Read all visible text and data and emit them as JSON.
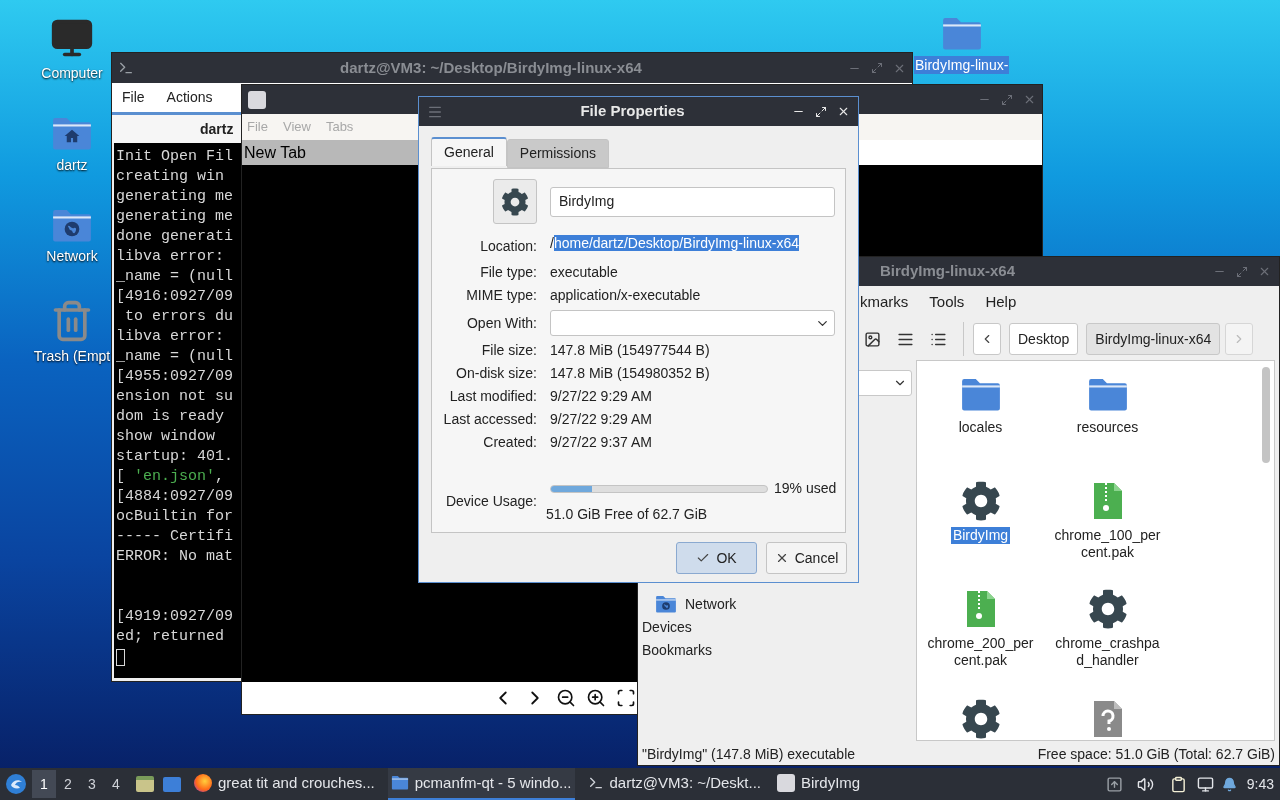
{
  "desktop": {
    "icons": [
      {
        "label": "Computer",
        "kind": "computer",
        "selected": false
      },
      {
        "label": "dartz",
        "kind": "home",
        "selected": false
      },
      {
        "label": "Network",
        "kind": "network",
        "selected": false
      },
      {
        "label": "Trash (Empt",
        "kind": "trash",
        "selected": false
      },
      {
        "label": "BirdyImg-linux-",
        "kind": "folder",
        "selected": true
      }
    ]
  },
  "terminal": {
    "title": "dartz@VM3: ~/Desktop/BirdyImg-linux-x64",
    "menu": [
      "File",
      "Actions"
    ],
    "tab": "dartz",
    "lines": [
      {
        "kind": "text",
        "segments": [
          {
            "text": "Init Open Fil",
            "kind": "plain"
          }
        ]
      },
      {
        "kind": "text",
        "segments": [
          {
            "text": "creating win",
            "kind": "plain"
          }
        ]
      },
      {
        "kind": "text",
        "segments": [
          {
            "text": "generating me",
            "kind": "plain"
          }
        ]
      },
      {
        "kind": "text",
        "segments": [
          {
            "text": "generating me",
            "kind": "plain"
          }
        ]
      },
      {
        "kind": "text",
        "segments": [
          {
            "text": "done generati",
            "kind": "plain"
          }
        ]
      },
      {
        "kind": "text",
        "segments": [
          {
            "text": "libva error:",
            "kind": "plain"
          }
        ]
      },
      {
        "kind": "text",
        "segments": [
          {
            "text": "_name = (null",
            "kind": "plain"
          }
        ]
      },
      {
        "kind": "text",
        "segments": [
          {
            "text": "[4916:0927/09",
            "kind": "plain"
          }
        ]
      },
      {
        "kind": "text",
        "segments": [
          {
            "text": " to errors du",
            "kind": "plain"
          }
        ]
      },
      {
        "kind": "text",
        "segments": [
          {
            "text": "libva error:",
            "kind": "plain"
          }
        ]
      },
      {
        "kind": "text",
        "segments": [
          {
            "text": "_name = (null",
            "kind": "plain"
          }
        ]
      },
      {
        "kind": "text",
        "segments": [
          {
            "text": "[4955:0927/09",
            "kind": "plain"
          }
        ]
      },
      {
        "kind": "text",
        "segments": [
          {
            "text": "ension not su",
            "kind": "plain"
          }
        ]
      },
      {
        "kind": "text",
        "segments": [
          {
            "text": "dom is ready",
            "kind": "plain"
          }
        ]
      },
      {
        "kind": "text",
        "segments": [
          {
            "text": "show window",
            "kind": "plain"
          }
        ]
      },
      {
        "kind": "text",
        "segments": [
          {
            "text": "startup: 401.",
            "kind": "plain"
          }
        ]
      },
      {
        "kind": "text",
        "segments": [
          {
            "text": "[ ",
            "kind": "plain"
          },
          {
            "text": "'en.json'",
            "kind": "string"
          },
          {
            "text": ",",
            "kind": "plain"
          }
        ]
      },
      {
        "kind": "text",
        "segments": [
          {
            "text": "[4884:0927/09",
            "kind": "plain"
          }
        ]
      },
      {
        "kind": "text",
        "segments": [
          {
            "text": "ocBuiltin for",
            "kind": "plain"
          }
        ]
      },
      {
        "kind": "text",
        "segments": [
          {
            "text": "----- Certifi",
            "kind": "plain"
          }
        ]
      },
      {
        "kind": "text",
        "segments": [
          {
            "text": "ERROR: No mat",
            "kind": "plain"
          }
        ]
      },
      {
        "kind": "blank"
      },
      {
        "kind": "blank"
      },
      {
        "kind": "text",
        "segments": [
          {
            "text": "[4919:0927/09",
            "kind": "plain"
          }
        ]
      },
      {
        "kind": "text",
        "segments": [
          {
            "text": "ed; returned",
            "kind": "plain"
          }
        ]
      },
      {
        "kind": "cursor"
      }
    ]
  },
  "viewer": {
    "menu": [
      {
        "label": "File",
        "disabled": true
      },
      {
        "label": "View",
        "disabled": true
      },
      {
        "label": "Tabs",
        "disabled": true
      }
    ],
    "tab": "New Tab"
  },
  "file_manager": {
    "title": "BirdyImg-linux-x64",
    "menu": [
      "kmarks",
      "Tools",
      "Help"
    ],
    "path": [
      {
        "label": "Desktop",
        "selected": false
      },
      {
        "label": "BirdyImg-linux-x64",
        "selected": true
      }
    ],
    "places": [
      {
        "label": "Network",
        "kind": "place"
      },
      {
        "label": "Devices",
        "kind": "header"
      },
      {
        "label": "Bookmarks",
        "kind": "header"
      }
    ],
    "files": [
      {
        "label": "locales",
        "kind": "folder",
        "selected": false
      },
      {
        "label": "resources",
        "kind": "folder",
        "selected": false
      },
      {
        "label": "BirdyImg",
        "kind": "executable",
        "selected": true
      },
      {
        "label": "chrome_100_per cent.pak",
        "kind": "archive",
        "selected": false
      },
      {
        "label": "chrome_200_per cent.pak",
        "kind": "archive",
        "selected": false
      },
      {
        "label": "chrome_crashpa d_handler",
        "kind": "executable",
        "selected": false
      },
      {
        "kind": "executable",
        "selected": false
      },
      {
        "kind": "unknown",
        "selected": false
      }
    ],
    "status_left": "\"BirdyImg\" (147.8 MiB) executable",
    "status_right": "Free space: 51.0 GiB (Total: 62.7 GiB)"
  },
  "dialog": {
    "title": "File Properties",
    "tabs": [
      {
        "label": "General",
        "selected": true
      },
      {
        "label": "Permissions",
        "selected": false
      }
    ],
    "name": "BirdyImg",
    "rows": [
      {
        "label": "Location:",
        "kind": "location",
        "prefix": "/",
        "selected_text": "home/dartz/Desktop/BirdyImg-linux-x64"
      },
      {
        "label": "File type:",
        "kind": "text",
        "value": "executable"
      },
      {
        "label": "MIME type:",
        "kind": "text",
        "value": "application/x-executable"
      },
      {
        "label": "Open With:",
        "kind": "dropdown"
      },
      {
        "label": "File size:",
        "kind": "text",
        "value": "147.8 MiB (154977544 B)"
      },
      {
        "label": "On-disk size:",
        "kind": "text",
        "value": "147.8 MiB (154980352 B)"
      },
      {
        "label": "Last modified:",
        "kind": "text",
        "value": "9/27/22 9:29 AM"
      },
      {
        "label": "Last accessed:",
        "kind": "text",
        "value": "9/27/22 9:29 AM"
      },
      {
        "label": "Created:",
        "kind": "text",
        "value": "9/27/22 9:37 AM"
      }
    ],
    "usage": {
      "label": "Device Usage:",
      "level": 0.19,
      "reading": "19% used",
      "free": "51.0 GiB Free of 62.7 GiB"
    },
    "buttons": [
      {
        "label": "OK",
        "kind": "ok"
      },
      {
        "label": "Cancel",
        "kind": "cancel"
      }
    ]
  },
  "taskbar": {
    "workspaces": [
      {
        "label": "1",
        "selected": true
      },
      {
        "label": "2",
        "selected": false
      },
      {
        "label": "3",
        "selected": false
      },
      {
        "label": "4",
        "selected": false
      }
    ],
    "tasks": [
      {
        "label": "great tit and crouches...",
        "kind": "browser",
        "selected": false
      },
      {
        "label": "pcmanfm-qt - 5 windo...",
        "kind": "folder",
        "selected": true
      },
      {
        "label": "dartz@VM3: ~/Deskt...",
        "kind": "terminal",
        "selected": false
      },
      {
        "label": "BirdyImg",
        "kind": "image",
        "selected": false
      }
    ],
    "clock": "9:43"
  }
}
